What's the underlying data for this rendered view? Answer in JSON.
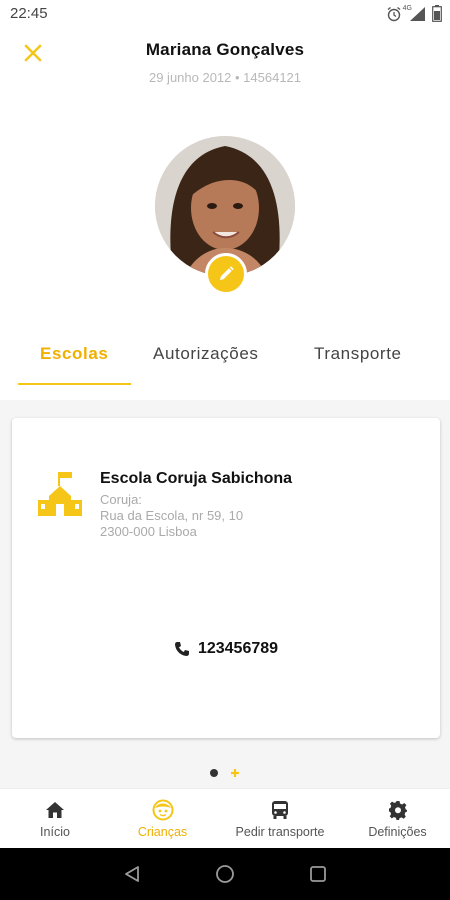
{
  "status_bar": {
    "time": "22:45",
    "network": "4G"
  },
  "header": {
    "name": "Mariana Gonçalves",
    "meta": "29 junho 2012 • 14564121"
  },
  "tabs": [
    {
      "label": "Escolas",
      "active": true
    },
    {
      "label": "Autorizações",
      "active": false
    },
    {
      "label": "Transporte",
      "active": false
    }
  ],
  "school": {
    "name": "Escola Coruja Sabichona",
    "line1": "Coruja:",
    "line2": "Rua da Escola, nr 59, 10",
    "line3": "2300-000 Lisboa",
    "phone": "123456789"
  },
  "pager": {
    "pages": 2,
    "current": 1
  },
  "bottom_nav": [
    {
      "label": "Início",
      "icon": "home-icon",
      "active": false
    },
    {
      "label": "Crianças",
      "icon": "child-face-icon",
      "active": true
    },
    {
      "label": "Pedir transporte",
      "icon": "bus-icon",
      "active": false
    },
    {
      "label": "Definições",
      "icon": "gear-icon",
      "active": false
    }
  ],
  "colors": {
    "accent": "#f5c518",
    "accent_text": "#f0b000",
    "muted": "#aaaaaa"
  }
}
